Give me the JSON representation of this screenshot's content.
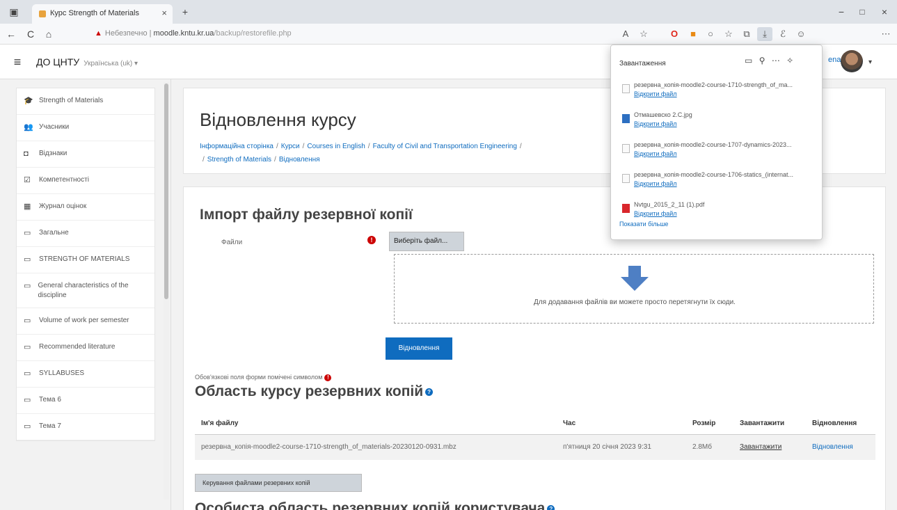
{
  "browser": {
    "tab_title": "Курс Strength of Materials",
    "tab_close": "×",
    "new_tab": "+",
    "window_controls": [
      "−",
      "□",
      "×"
    ],
    "nav_buttons": [
      "←",
      "C",
      "⌂"
    ],
    "security_label": "Небезпечно",
    "url_host": "moodle.kntu.kr.ua",
    "url_path": "/backup/restorefile.php",
    "extension_icons": [
      "A",
      "☆",
      "O",
      "■",
      "○",
      "☆",
      "⧉",
      "⤓",
      "ℰ",
      "☺",
      "⋯"
    ]
  },
  "navbar": {
    "menu_icon": "≡",
    "brand": "ДО ЦНТУ",
    "language": "Українська (uk) ▾",
    "user_name": "enadiy",
    "user_caret": "▾"
  },
  "sidebar": {
    "items": [
      {
        "icon": "graduation-cap-icon",
        "glyph": "🎓",
        "label": "Strength of Materials"
      },
      {
        "icon": "users-icon",
        "glyph": "👥",
        "label": "Учасники"
      },
      {
        "icon": "shield-icon",
        "glyph": "◘",
        "label": "Відзнаки"
      },
      {
        "icon": "checklist-icon",
        "glyph": "☑",
        "label": "Компетентності"
      },
      {
        "icon": "table-icon",
        "glyph": "▦",
        "label": "Журнал оцінок"
      },
      {
        "icon": "folder-icon",
        "glyph": "▭",
        "label": "Загальне"
      },
      {
        "icon": "folder-icon",
        "glyph": "▭",
        "label": "STRENGTH OF MATERIALS"
      },
      {
        "icon": "folder-icon",
        "glyph": "▭",
        "label": "General characteristics of the discipline"
      },
      {
        "icon": "folder-icon",
        "glyph": "▭",
        "label": "Volume of work per semester"
      },
      {
        "icon": "folder-icon",
        "glyph": "▭",
        "label": "Recommended literature"
      },
      {
        "icon": "folder-icon",
        "glyph": "▭",
        "label": "SYLLABUSES"
      },
      {
        "icon": "folder-icon",
        "glyph": "▭",
        "label": "Тема 6"
      },
      {
        "icon": "folder-icon",
        "glyph": "▭",
        "label": "Тема 7"
      }
    ]
  },
  "main": {
    "page_title": "Відновлення курсу",
    "breadcrumb": [
      "Інформаційна сторінка",
      "Курси",
      "Courses in English",
      "Faculty of Civil and Transportation Engineering",
      "",
      "Strength of Materials",
      "Відновлення"
    ],
    "breadcrumb_sep": "/",
    "import_title": "Імпорт файлу резервної копії",
    "files_label": "Файли",
    "required_mark": "!",
    "choose_file_button": "Виберіть файл...",
    "drop_text": "Для додавання файлів ви можете просто перетягнути їх сюди.",
    "restore_button": "Відновлення",
    "required_note": "Обов'язкові поля форми помічені символом",
    "area_title": "Область курсу резервних копій",
    "help_mark": "?",
    "table": {
      "headers": [
        "Ім'я файлу",
        "Час",
        "Розмір",
        "Завантажити",
        "Відновлення"
      ],
      "rows": [
        {
          "file": "резервна_копія-moodle2-course-1710-strength_of_materials-20230120-0931.mbz",
          "time": "п'ятниця 20 січня 2023 9:31",
          "size": "2.8Мб",
          "download": "Завантажити",
          "restore": "Відновлення"
        }
      ]
    },
    "manage_button": "Керування файлами резервних копій",
    "user_area_title": "Особиста область резервних копій користувача"
  },
  "downloads": {
    "title": "Завантаження",
    "tools": [
      "▭",
      "⚲",
      "⋯",
      "✧"
    ],
    "items": [
      {
        "name": "резервна_копія-moodle2-course-1710-strength_of_ma...",
        "action": "Відкрити файл",
        "type": "generic"
      },
      {
        "name": "Отмашевско 2.С.jpg",
        "action": "Відкрити файл",
        "type": "img"
      },
      {
        "name": "резервна_копія-moodle2-course-1707-dynamics-2023...",
        "action": "Відкрити файл",
        "type": "generic"
      },
      {
        "name": "резервна_копія-moodle2-course-1706-statics_(internat...",
        "action": "Відкрити файл",
        "type": "generic"
      },
      {
        "name": "Nvtgu_2015_2_11 (1).pdf",
        "action": "Відкрити файл",
        "type": "pdf"
      }
    ],
    "show_more": "Показати більше"
  },
  "colors": {
    "primary": "#0f6cbf",
    "required": "#cc0000",
    "background": "#f2f2f2"
  }
}
